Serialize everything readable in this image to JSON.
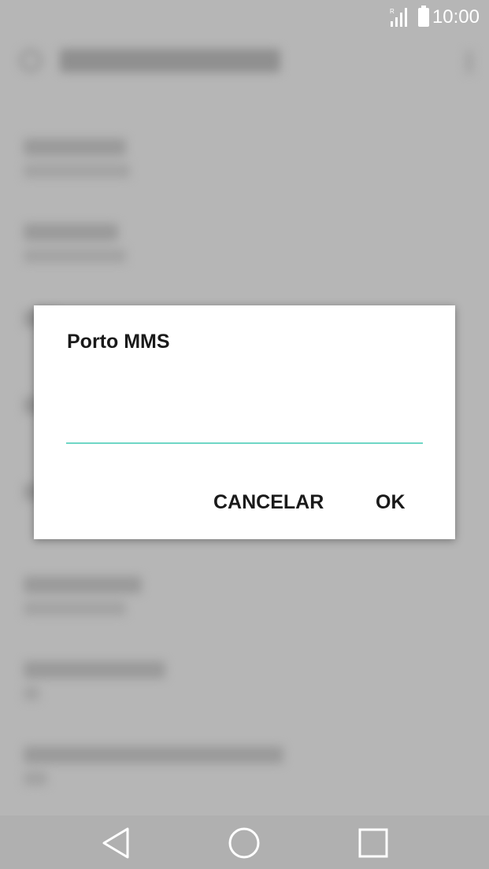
{
  "status_bar": {
    "time": "10:00",
    "signal_icon": "signal-roaming-icon",
    "battery_icon": "battery-full-icon"
  },
  "dialog": {
    "title": "Porto MMS",
    "input": {
      "value": "",
      "placeholder": ""
    },
    "cancel_label": "CANCELAR",
    "ok_label": "OK",
    "accent_color": "#6fd6c6"
  },
  "nav_bar": {
    "back_icon": "back-triangle-icon",
    "home_icon": "home-circle-icon",
    "recents_icon": "recents-square-icon"
  }
}
